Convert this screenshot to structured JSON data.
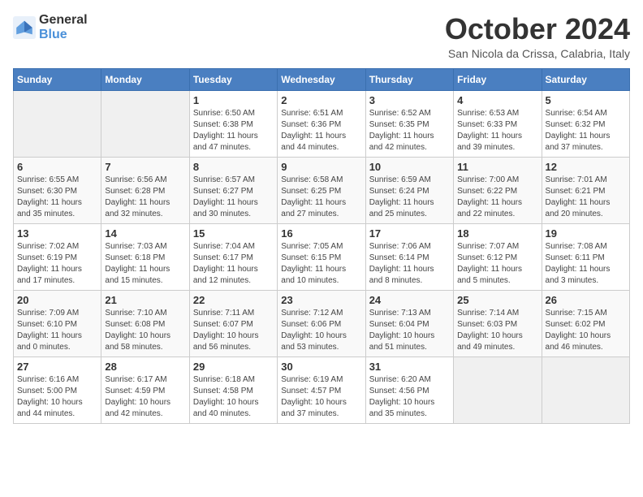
{
  "logo": {
    "line1": "General",
    "line2": "Blue"
  },
  "title": "October 2024",
  "location": "San Nicola da Crissa, Calabria, Italy",
  "weekdays": [
    "Sunday",
    "Monday",
    "Tuesday",
    "Wednesday",
    "Thursday",
    "Friday",
    "Saturday"
  ],
  "weeks": [
    [
      {
        "day": "",
        "info": ""
      },
      {
        "day": "",
        "info": ""
      },
      {
        "day": "1",
        "info": "Sunrise: 6:50 AM\nSunset: 6:38 PM\nDaylight: 11 hours\nand 47 minutes."
      },
      {
        "day": "2",
        "info": "Sunrise: 6:51 AM\nSunset: 6:36 PM\nDaylight: 11 hours\nand 44 minutes."
      },
      {
        "day": "3",
        "info": "Sunrise: 6:52 AM\nSunset: 6:35 PM\nDaylight: 11 hours\nand 42 minutes."
      },
      {
        "day": "4",
        "info": "Sunrise: 6:53 AM\nSunset: 6:33 PM\nDaylight: 11 hours\nand 39 minutes."
      },
      {
        "day": "5",
        "info": "Sunrise: 6:54 AM\nSunset: 6:32 PM\nDaylight: 11 hours\nand 37 minutes."
      }
    ],
    [
      {
        "day": "6",
        "info": "Sunrise: 6:55 AM\nSunset: 6:30 PM\nDaylight: 11 hours\nand 35 minutes."
      },
      {
        "day": "7",
        "info": "Sunrise: 6:56 AM\nSunset: 6:28 PM\nDaylight: 11 hours\nand 32 minutes."
      },
      {
        "day": "8",
        "info": "Sunrise: 6:57 AM\nSunset: 6:27 PM\nDaylight: 11 hours\nand 30 minutes."
      },
      {
        "day": "9",
        "info": "Sunrise: 6:58 AM\nSunset: 6:25 PM\nDaylight: 11 hours\nand 27 minutes."
      },
      {
        "day": "10",
        "info": "Sunrise: 6:59 AM\nSunset: 6:24 PM\nDaylight: 11 hours\nand 25 minutes."
      },
      {
        "day": "11",
        "info": "Sunrise: 7:00 AM\nSunset: 6:22 PM\nDaylight: 11 hours\nand 22 minutes."
      },
      {
        "day": "12",
        "info": "Sunrise: 7:01 AM\nSunset: 6:21 PM\nDaylight: 11 hours\nand 20 minutes."
      }
    ],
    [
      {
        "day": "13",
        "info": "Sunrise: 7:02 AM\nSunset: 6:19 PM\nDaylight: 11 hours\nand 17 minutes."
      },
      {
        "day": "14",
        "info": "Sunrise: 7:03 AM\nSunset: 6:18 PM\nDaylight: 11 hours\nand 15 minutes."
      },
      {
        "day": "15",
        "info": "Sunrise: 7:04 AM\nSunset: 6:17 PM\nDaylight: 11 hours\nand 12 minutes."
      },
      {
        "day": "16",
        "info": "Sunrise: 7:05 AM\nSunset: 6:15 PM\nDaylight: 11 hours\nand 10 minutes."
      },
      {
        "day": "17",
        "info": "Sunrise: 7:06 AM\nSunset: 6:14 PM\nDaylight: 11 hours\nand 8 minutes."
      },
      {
        "day": "18",
        "info": "Sunrise: 7:07 AM\nSunset: 6:12 PM\nDaylight: 11 hours\nand 5 minutes."
      },
      {
        "day": "19",
        "info": "Sunrise: 7:08 AM\nSunset: 6:11 PM\nDaylight: 11 hours\nand 3 minutes."
      }
    ],
    [
      {
        "day": "20",
        "info": "Sunrise: 7:09 AM\nSunset: 6:10 PM\nDaylight: 11 hours\nand 0 minutes."
      },
      {
        "day": "21",
        "info": "Sunrise: 7:10 AM\nSunset: 6:08 PM\nDaylight: 10 hours\nand 58 minutes."
      },
      {
        "day": "22",
        "info": "Sunrise: 7:11 AM\nSunset: 6:07 PM\nDaylight: 10 hours\nand 56 minutes."
      },
      {
        "day": "23",
        "info": "Sunrise: 7:12 AM\nSunset: 6:06 PM\nDaylight: 10 hours\nand 53 minutes."
      },
      {
        "day": "24",
        "info": "Sunrise: 7:13 AM\nSunset: 6:04 PM\nDaylight: 10 hours\nand 51 minutes."
      },
      {
        "day": "25",
        "info": "Sunrise: 7:14 AM\nSunset: 6:03 PM\nDaylight: 10 hours\nand 49 minutes."
      },
      {
        "day": "26",
        "info": "Sunrise: 7:15 AM\nSunset: 6:02 PM\nDaylight: 10 hours\nand 46 minutes."
      }
    ],
    [
      {
        "day": "27",
        "info": "Sunrise: 6:16 AM\nSunset: 5:00 PM\nDaylight: 10 hours\nand 44 minutes."
      },
      {
        "day": "28",
        "info": "Sunrise: 6:17 AM\nSunset: 4:59 PM\nDaylight: 10 hours\nand 42 minutes."
      },
      {
        "day": "29",
        "info": "Sunrise: 6:18 AM\nSunset: 4:58 PM\nDaylight: 10 hours\nand 40 minutes."
      },
      {
        "day": "30",
        "info": "Sunrise: 6:19 AM\nSunset: 4:57 PM\nDaylight: 10 hours\nand 37 minutes."
      },
      {
        "day": "31",
        "info": "Sunrise: 6:20 AM\nSunset: 4:56 PM\nDaylight: 10 hours\nand 35 minutes."
      },
      {
        "day": "",
        "info": ""
      },
      {
        "day": "",
        "info": ""
      }
    ]
  ]
}
